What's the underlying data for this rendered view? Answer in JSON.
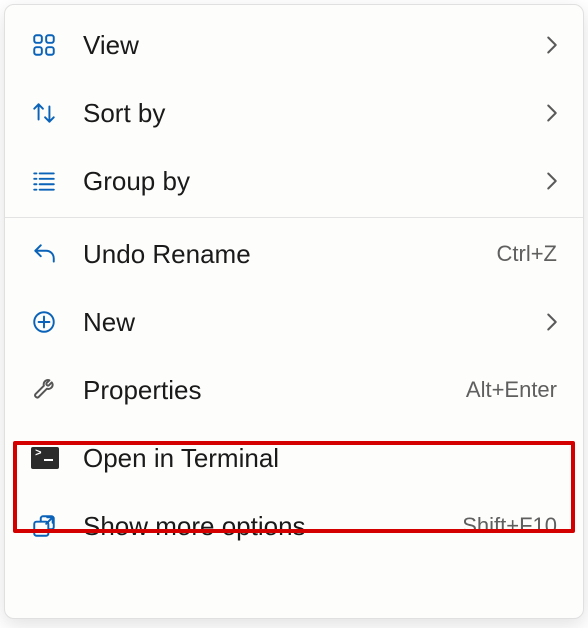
{
  "menu": {
    "items": [
      {
        "label": "View",
        "submenu": true,
        "shortcut": ""
      },
      {
        "label": "Sort by",
        "submenu": true,
        "shortcut": ""
      },
      {
        "label": "Group by",
        "submenu": true,
        "shortcut": ""
      },
      {
        "label": "Undo Rename",
        "submenu": false,
        "shortcut": "Ctrl+Z"
      },
      {
        "label": "New",
        "submenu": true,
        "shortcut": ""
      },
      {
        "label": "Properties",
        "submenu": false,
        "shortcut": "Alt+Enter"
      },
      {
        "label": "Open in Terminal",
        "submenu": false,
        "shortcut": ""
      },
      {
        "label": "Show more options",
        "submenu": false,
        "shortcut": "Shift+F10"
      }
    ]
  },
  "colors": {
    "icon_blue": "#0a63b8",
    "highlight": "#d40000"
  }
}
